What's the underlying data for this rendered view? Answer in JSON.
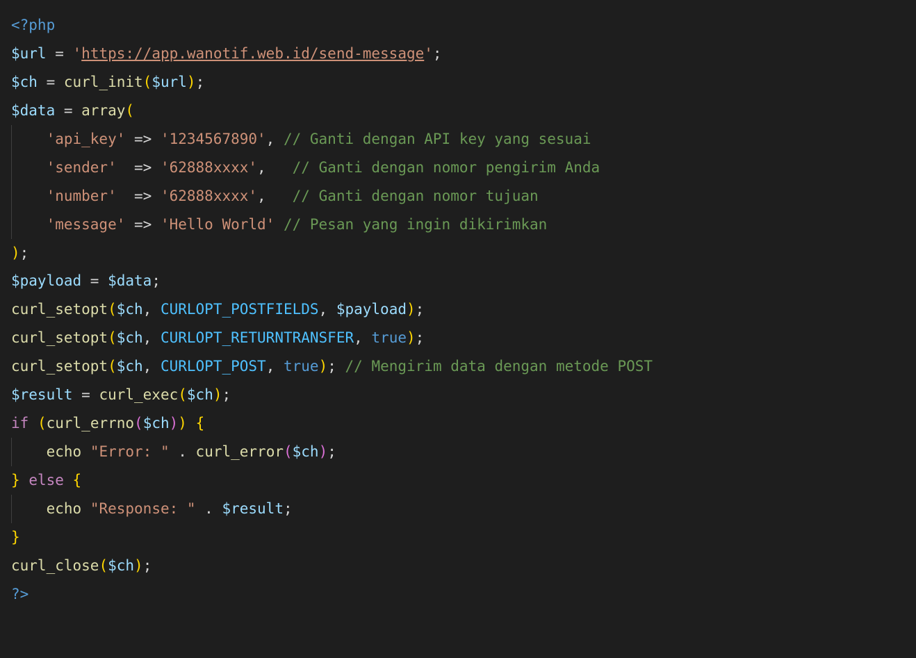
{
  "code": {
    "open_tag": "<?php",
    "url_var": "$url",
    "eq": " = ",
    "url_q1": "'",
    "url_val": "https://app.wanotif.web.id/send-message",
    "url_q2": "'",
    "semi": ";",
    "ch_var": "$ch",
    "curl_init": "curl_init",
    "data_var": "$data",
    "array_kw": "array",
    "arr": {
      "k1": "'api_key'",
      "arrow": " => ",
      "v1": "'1234567890'",
      "comma": ",",
      "c1": " // Ganti dengan API key yang sesuai",
      "k2": "'sender'",
      "v2_pad": " ",
      "v2": "'62888xxxx'",
      "c2_pad": "   ",
      "c2": "// Ganti dengan nomor pengirim Anda",
      "k3": "'number'",
      "v3_pad": " ",
      "v3": "'62888xxxx'",
      "c3_pad": "   ",
      "c3": "// Ganti dengan nomor tujuan",
      "k4": "'message'",
      "v4": "'Hello World'",
      "c4": " // Pesan yang ingin dikirimkan"
    },
    "payload_var": "$payload",
    "curl_setopt": "curl_setopt",
    "copt_postfields": "CURLOPT_POSTFIELDS",
    "copt_returntransfer": "CURLOPT_RETURNTRANSFER",
    "copt_post": "CURLOPT_POST",
    "true": "true",
    "post_comment": " // Mengirim data dengan metode POST",
    "result_var": "$result",
    "curl_exec": "curl_exec",
    "if_kw": "if",
    "curl_errno": "curl_errno",
    "echo_kw": "echo",
    "err_str": "\"Error: \"",
    "dot": " . ",
    "curl_error": "curl_error",
    "else_kw": "else",
    "resp_str": "\"Response: \"",
    "curl_close": "curl_close",
    "close_tag": "?>",
    "sp": " ",
    "comma_sp": ", ",
    "lb_y": "{",
    "rb_y": "}"
  }
}
